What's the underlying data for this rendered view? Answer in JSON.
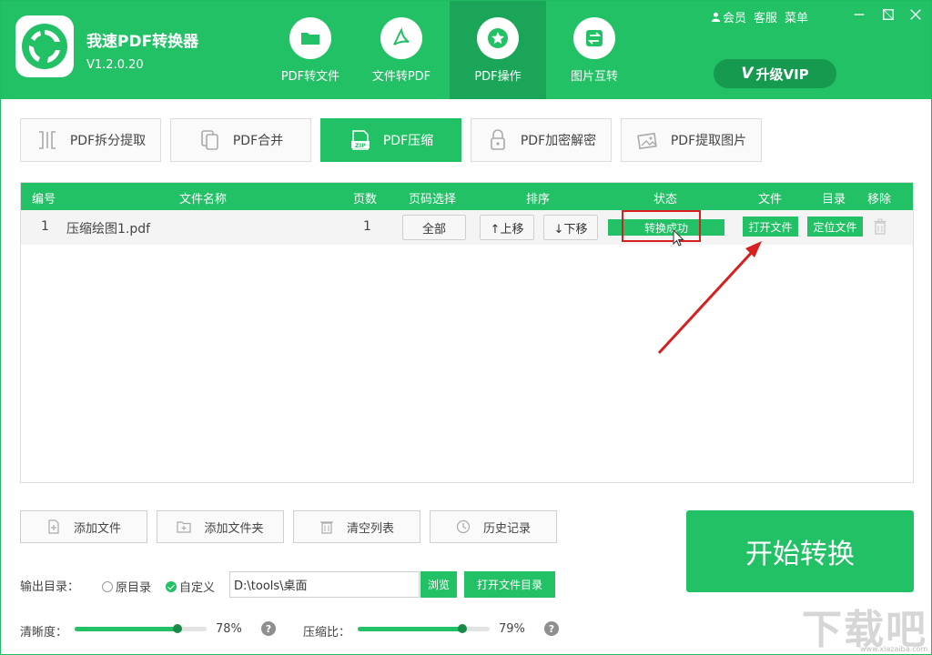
{
  "app": {
    "title": "我速PDF转换器",
    "version": "V1.2.0.20",
    "brand_color": "#23c165",
    "active_tab_color": "#1aa558"
  },
  "top_links": {
    "member": "会员",
    "service": "客服",
    "menu": "菜单"
  },
  "vip_button": {
    "mark": "V",
    "label": "升级VIP"
  },
  "nav_tabs": [
    {
      "label": "PDF转文件",
      "icon": "folder-icon",
      "active": false
    },
    {
      "label": "文件转PDF",
      "icon": "pdf-icon",
      "active": false
    },
    {
      "label": "PDF操作",
      "icon": "star-icon",
      "active": true
    },
    {
      "label": "图片互转",
      "icon": "swap-icon",
      "active": false
    }
  ],
  "sub_tabs": [
    {
      "label": "PDF拆分提取",
      "icon": "split-icon",
      "active": false
    },
    {
      "label": "PDF合并",
      "icon": "merge-icon",
      "active": false
    },
    {
      "label": "PDF压缩",
      "icon": "zip-icon",
      "active": true
    },
    {
      "label": "PDF加密解密",
      "icon": "lock-icon",
      "active": false
    },
    {
      "label": "PDF提取图片",
      "icon": "image-icon",
      "active": false
    }
  ],
  "table": {
    "headers": {
      "index": "编号",
      "name": "文件名称",
      "pages": "页数",
      "page_select": "页码选择",
      "sort": "排序",
      "status": "状态",
      "file": "文件",
      "dir": "目录",
      "remove": "移除"
    },
    "rows": [
      {
        "index": "1",
        "name": "压缩绘图1.pdf",
        "pages": "1",
        "page_select": "全部",
        "move_up": "↑上移",
        "move_down": "↓下移",
        "status": "转换成功",
        "open_file": "打开文件",
        "locate_file": "定位文件"
      }
    ]
  },
  "tools": {
    "add_file": "添加文件",
    "add_folder": "添加文件夹",
    "clear_list": "清空列表",
    "history": "历史记录"
  },
  "start_button": "开始转换",
  "output": {
    "label": "输出目录：",
    "option_original": "原目录",
    "option_custom": "自定义",
    "selected": "自定义",
    "path": "D:\\tools\\桌面",
    "browse": "浏览",
    "open_dir": "打开文件目录"
  },
  "sliders": {
    "clarity": {
      "label": "清晰度：",
      "value_text": "78%",
      "value": 0.78
    },
    "ratio": {
      "label": "压缩比：",
      "value_text": "79%",
      "value": 0.79
    }
  },
  "help_glyph": "?",
  "watermark": {
    "text": "下载吧",
    "url": "www.xiazaiba.com"
  }
}
